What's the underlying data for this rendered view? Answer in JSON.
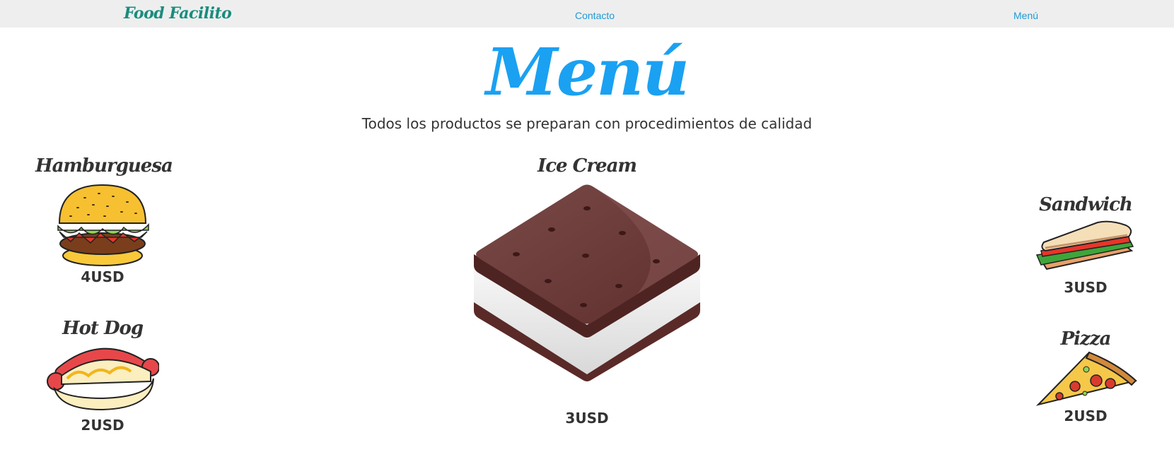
{
  "nav": {
    "brand": "Food Facilito",
    "links": [
      {
        "label": "Contacto"
      },
      {
        "label": "Menú"
      }
    ]
  },
  "header": {
    "title": "Menú",
    "subtitle": "Todos los productos se preparan con procedimientos de calidad"
  },
  "menu_items": [
    {
      "name": "Hamburguesa",
      "price": "4USD",
      "icon": "hamburger-icon"
    },
    {
      "name": "Hot Dog",
      "price": "2USD",
      "icon": "hotdog-icon"
    },
    {
      "name": "Ice Cream",
      "price": "3USD",
      "icon": "ice-cream-sandwich-icon"
    },
    {
      "name": "Sandwich",
      "price": "3USD",
      "icon": "sandwich-icon"
    },
    {
      "name": "Pizza",
      "price": "2USD",
      "icon": "pizza-slice-icon"
    }
  ],
  "colors": {
    "brand": "#1a8c7e",
    "title": "#1aa1f2",
    "link": "#1e9ad6",
    "navbar_bg": "#eeeeee",
    "text": "#333333"
  }
}
